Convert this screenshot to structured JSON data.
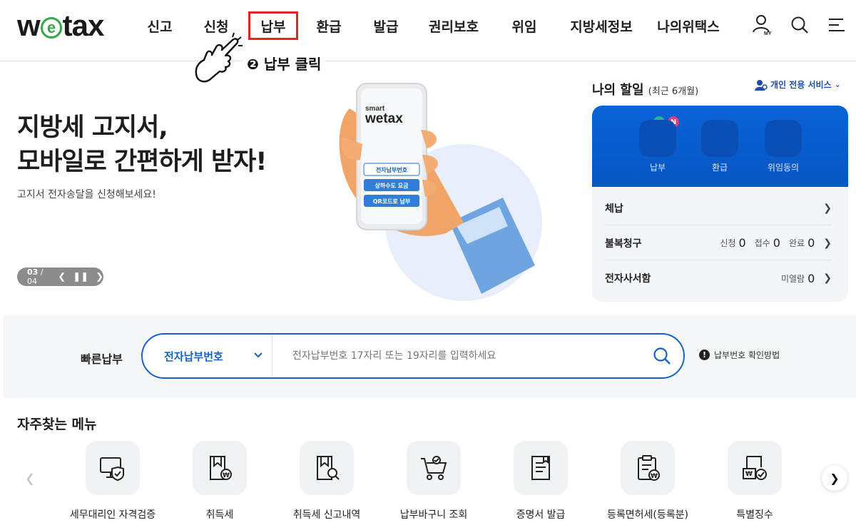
{
  "header": {
    "logo_text_pre": "w",
    "logo_text_e": "e",
    "logo_text_post": "tax",
    "nav": [
      "신고",
      "신청",
      "납부",
      "환급",
      "발급",
      "권리보호",
      "위임",
      "지방세정보",
      "나의위택스"
    ],
    "highlighted_nav": "납부",
    "my_label": "MY",
    "icons": [
      "user-icon",
      "search-icon",
      "menu-icon"
    ]
  },
  "annotation": {
    "text": "❷ 납부 클릭"
  },
  "hero": {
    "title_line1": "지방세 고지서,",
    "title_line2": "모바일로 간편하게 받자!",
    "subtitle": "고지서 전자송달을 신청해보세요!",
    "page_current": "03",
    "page_total": "/ 04",
    "phone": {
      "brand_small": "smart",
      "brand": "wetax",
      "btn1": "전자납부번호",
      "btn2": "상하수도 요금",
      "btn3": "QR코드로 납부"
    }
  },
  "tasks": {
    "title": "나의 할일",
    "period": "(최근 6개월)",
    "service_link": "개인 전용 서비스",
    "quick_items": [
      "납부",
      "환급",
      "위임동의"
    ],
    "badge_plus": "+",
    "badge_n": "N",
    "rows": [
      {
        "name": "체납",
        "stats": []
      },
      {
        "name": "불복청구",
        "stats": [
          {
            "label": "신청",
            "value": "0"
          },
          {
            "label": "접수",
            "value": "0"
          },
          {
            "label": "완료",
            "value": "0"
          }
        ]
      },
      {
        "name": "전자사서함",
        "stats": [
          {
            "label": "미열람",
            "value": "0"
          }
        ]
      }
    ]
  },
  "quickpay": {
    "label": "빠른납부",
    "select_value": "전자납부번호",
    "placeholder": "전자납부번호 17자리 또는 19자리를 입력하세요",
    "help": "납부번호 확인방법",
    "help_mark": "!"
  },
  "frequent": {
    "title": "자주찾는 메뉴",
    "items": [
      {
        "label": "세무대리인 자격검증",
        "icon": "monitor-shield-icon"
      },
      {
        "label": "취득세",
        "icon": "document-won-icon"
      },
      {
        "label": "취득세 신고내역",
        "icon": "document-search-icon"
      },
      {
        "label": "납부바구니 조회",
        "icon": "cart-icon"
      },
      {
        "label": "증명서 발급",
        "icon": "certificate-icon"
      },
      {
        "label": "등록면허세(등록분)",
        "icon": "clipboard-won-icon"
      },
      {
        "label": "특별징수",
        "icon": "document-check-icon"
      }
    ]
  },
  "colors": {
    "primary": "#1462c8",
    "tasks_blue": "#0a63d8",
    "highlight": "#e32222",
    "logo_green": "#33a845"
  }
}
